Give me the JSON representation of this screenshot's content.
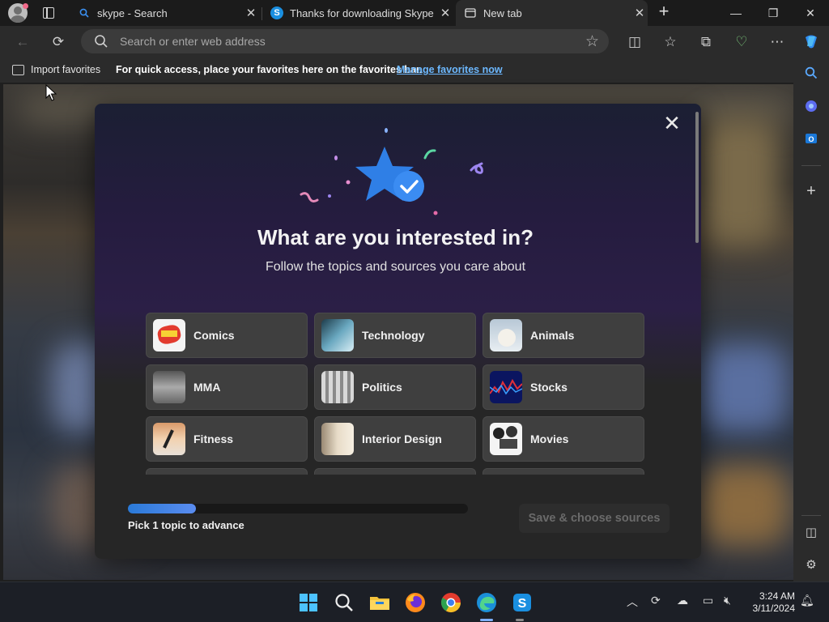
{
  "tabs": [
    {
      "title": "skype - Search",
      "icon": "search-icon"
    },
    {
      "title": "Thanks for downloading Skype",
      "icon": "skype-icon"
    },
    {
      "title": "New tab",
      "icon": "newtab-icon",
      "active": true
    }
  ],
  "address_bar": {
    "placeholder": "Search or enter web address"
  },
  "favorites_bar": {
    "import_label": "Import favorites",
    "message": "For quick access, place your favorites here on the favorites bar.",
    "manage_link": "Manage favorites now"
  },
  "dialog": {
    "title": "What are you interested in?",
    "subtitle": "Follow the topics and sources you care about",
    "topics": [
      {
        "label": "Comics",
        "icon": "comics-thumb"
      },
      {
        "label": "Technology",
        "icon": "technology-thumb"
      },
      {
        "label": "Animals",
        "icon": "animals-thumb"
      },
      {
        "label": "MMA",
        "icon": "mma-thumb"
      },
      {
        "label": "Politics",
        "icon": "politics-thumb"
      },
      {
        "label": "Stocks",
        "icon": "stocks-thumb"
      },
      {
        "label": "Fitness",
        "icon": "fitness-thumb"
      },
      {
        "label": "Interior Design",
        "icon": "interior-design-thumb"
      },
      {
        "label": "Movies",
        "icon": "movies-thumb"
      }
    ],
    "progress": 0.2,
    "pick_text": "Pick 1 topic to advance",
    "save_button": "Save & choose sources"
  },
  "taskbar": {
    "time": "3:24 AM",
    "date": "3/11/2024",
    "apps": [
      "windows-start-icon",
      "search-icon",
      "file-explorer-icon",
      "firefox-icon",
      "chrome-icon",
      "edge-icon",
      "skype-icon"
    ]
  },
  "colors": {
    "accent": "#2a7ad8",
    "link": "#6cb8ff",
    "dialog_bg": "#262626"
  }
}
